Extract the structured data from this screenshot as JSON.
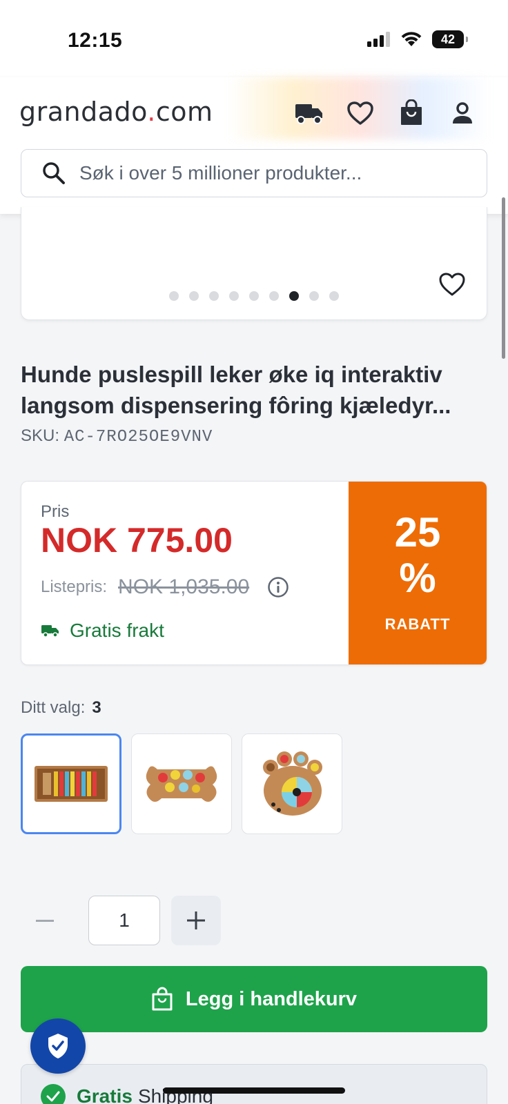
{
  "status_bar": {
    "time": "12:15",
    "battery": "42"
  },
  "header": {
    "logo_main": "grandado",
    "logo_dot": ".",
    "logo_tld": "com",
    "icons": [
      "truck-icon",
      "heart-icon",
      "shopping-bag-icon",
      "user-icon"
    ],
    "search_placeholder": "Søk i over 5 millioner produkter..."
  },
  "gallery": {
    "dot_count": 9,
    "active_index": 6
  },
  "product": {
    "title": "Hunde puslespill leker øke iq interaktiv langsom dispensering fôring kjæledyr...",
    "sku_label": "SKU:",
    "sku_value": "AC-7RO25OE9VNV"
  },
  "price": {
    "label": "Pris",
    "current": "NOK 775.00",
    "list_label": "Listepris:",
    "list_price": "NOK 1,035.00",
    "shipping": "Gratis frakt",
    "discount_number": "25",
    "discount_percent": "%",
    "discount_word": "RABATT"
  },
  "variants": {
    "label": "Ditt valg:",
    "selected": "3",
    "items": [
      {
        "name": "variant-rectangle-puzzle",
        "selected": true
      },
      {
        "name": "variant-bone-puzzle",
        "selected": false
      },
      {
        "name": "variant-paw-puzzle",
        "selected": false
      }
    ]
  },
  "quantity": {
    "value": "1"
  },
  "cart": {
    "button_label": "Legg i handlekurv"
  },
  "info": {
    "free": "Gratis",
    "shipping": "Shipping"
  },
  "colors": {
    "price_red": "#d42a2a",
    "discount_orange": "#ee6c05",
    "cart_green": "#1ea34b",
    "shipping_green": "#177a3a",
    "selected_blue": "#4b86f0"
  }
}
